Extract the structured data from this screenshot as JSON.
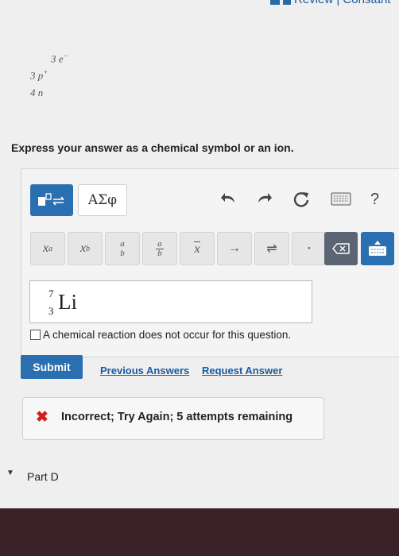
{
  "header": {
    "links_text": "Review | Constant"
  },
  "atom": {
    "electrons": "3 e",
    "electron_sup": "−",
    "protons": "3 p",
    "proton_sup": "+",
    "neutrons": "4 n"
  },
  "prompt": "Express your answer as a chemical symbol or an ion.",
  "toolbar": {
    "symbol_palette_label": "ΑΣφ",
    "help_label": "?",
    "row2": {
      "superscript_base": "x",
      "superscript_exp": "a",
      "subscript_base": "x",
      "subscript_sub": "b",
      "fraction_num": "a",
      "fraction_den": "b",
      "mixed_num": "a",
      "mixed_den": "b",
      "vector_label": "x",
      "arrow_label": "→",
      "equilibrium_label": "⇌",
      "dot_label": "•"
    }
  },
  "answer": {
    "mass_number": "7",
    "atomic_number": "3",
    "symbol": "Li"
  },
  "no_reaction_label": "A chemical reaction does not occur for this question.",
  "actions": {
    "submit_label": "Submit",
    "previous_answers_label": "Previous Answers",
    "request_answer_label": "Request Answer"
  },
  "feedback": {
    "icon": "✖",
    "message": "Incorrect; Try Again; 5 attempts remaining"
  },
  "next_part": {
    "label": "Part D"
  },
  "colors": {
    "primary_blue": "#2a6fb0",
    "error_red": "#d31e1e",
    "link_blue": "#1a5aa0"
  }
}
